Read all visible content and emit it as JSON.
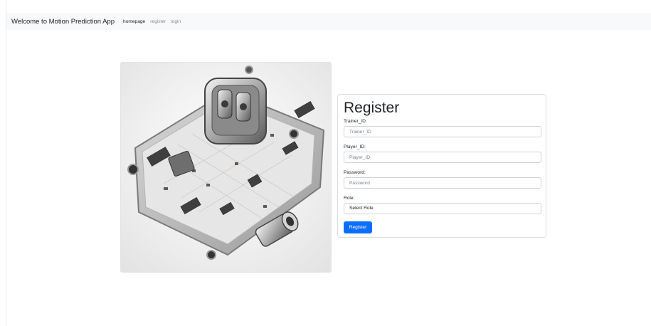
{
  "navbar": {
    "brand": "Welcome to Motion Prediction App",
    "links": [
      {
        "label": "homepage",
        "active": true
      },
      {
        "label": "register",
        "active": false
      },
      {
        "label": "login",
        "active": false
      }
    ]
  },
  "form": {
    "title": "Register",
    "trainer_label": "Trainer_ID:",
    "trainer_placeholder": "Trainer_ID",
    "player_label": "Player_ID:",
    "player_placeholder": "Player_ID",
    "password_label": "Password:",
    "password_placeholder": "Password",
    "role_label": "Role:",
    "role_selected": "Select Role",
    "submit_label": "Register"
  },
  "colors": {
    "primary": "#0d6efd",
    "navbar_bg": "#f8f9fa"
  },
  "image": {
    "icon": "circuit-board-image"
  }
}
